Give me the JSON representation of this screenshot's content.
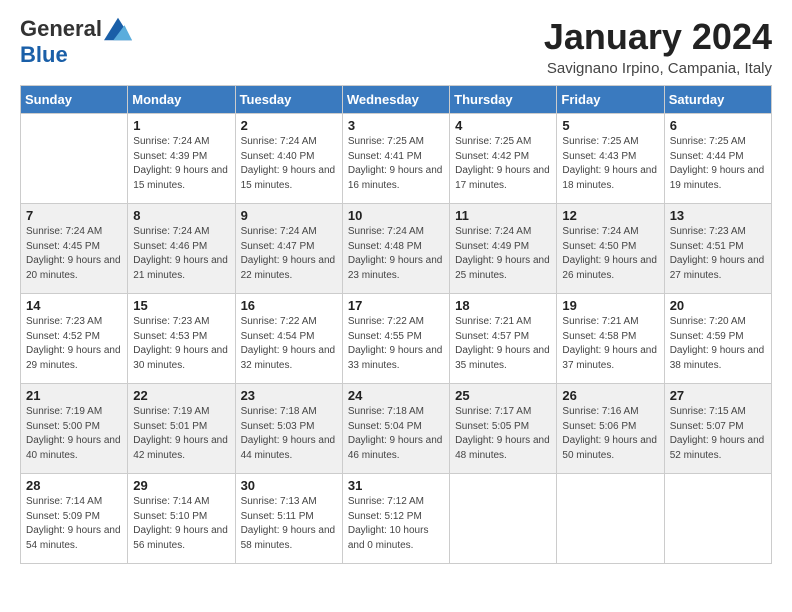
{
  "logo": {
    "general": "General",
    "blue": "Blue"
  },
  "title": "January 2024",
  "subtitle": "Savignano Irpino, Campania, Italy",
  "weekdays": [
    "Sunday",
    "Monday",
    "Tuesday",
    "Wednesday",
    "Thursday",
    "Friday",
    "Saturday"
  ],
  "weeks": [
    [
      {
        "day": "",
        "sunrise": "",
        "sunset": "",
        "daylight": ""
      },
      {
        "day": "1",
        "sunrise": "Sunrise: 7:24 AM",
        "sunset": "Sunset: 4:39 PM",
        "daylight": "Daylight: 9 hours and 15 minutes."
      },
      {
        "day": "2",
        "sunrise": "Sunrise: 7:24 AM",
        "sunset": "Sunset: 4:40 PM",
        "daylight": "Daylight: 9 hours and 15 minutes."
      },
      {
        "day": "3",
        "sunrise": "Sunrise: 7:25 AM",
        "sunset": "Sunset: 4:41 PM",
        "daylight": "Daylight: 9 hours and 16 minutes."
      },
      {
        "day": "4",
        "sunrise": "Sunrise: 7:25 AM",
        "sunset": "Sunset: 4:42 PM",
        "daylight": "Daylight: 9 hours and 17 minutes."
      },
      {
        "day": "5",
        "sunrise": "Sunrise: 7:25 AM",
        "sunset": "Sunset: 4:43 PM",
        "daylight": "Daylight: 9 hours and 18 minutes."
      },
      {
        "day": "6",
        "sunrise": "Sunrise: 7:25 AM",
        "sunset": "Sunset: 4:44 PM",
        "daylight": "Daylight: 9 hours and 19 minutes."
      }
    ],
    [
      {
        "day": "7",
        "sunrise": "Sunrise: 7:24 AM",
        "sunset": "Sunset: 4:45 PM",
        "daylight": "Daylight: 9 hours and 20 minutes."
      },
      {
        "day": "8",
        "sunrise": "Sunrise: 7:24 AM",
        "sunset": "Sunset: 4:46 PM",
        "daylight": "Daylight: 9 hours and 21 minutes."
      },
      {
        "day": "9",
        "sunrise": "Sunrise: 7:24 AM",
        "sunset": "Sunset: 4:47 PM",
        "daylight": "Daylight: 9 hours and 22 minutes."
      },
      {
        "day": "10",
        "sunrise": "Sunrise: 7:24 AM",
        "sunset": "Sunset: 4:48 PM",
        "daylight": "Daylight: 9 hours and 23 minutes."
      },
      {
        "day": "11",
        "sunrise": "Sunrise: 7:24 AM",
        "sunset": "Sunset: 4:49 PM",
        "daylight": "Daylight: 9 hours and 25 minutes."
      },
      {
        "day": "12",
        "sunrise": "Sunrise: 7:24 AM",
        "sunset": "Sunset: 4:50 PM",
        "daylight": "Daylight: 9 hours and 26 minutes."
      },
      {
        "day": "13",
        "sunrise": "Sunrise: 7:23 AM",
        "sunset": "Sunset: 4:51 PM",
        "daylight": "Daylight: 9 hours and 27 minutes."
      }
    ],
    [
      {
        "day": "14",
        "sunrise": "Sunrise: 7:23 AM",
        "sunset": "Sunset: 4:52 PM",
        "daylight": "Daylight: 9 hours and 29 minutes."
      },
      {
        "day": "15",
        "sunrise": "Sunrise: 7:23 AM",
        "sunset": "Sunset: 4:53 PM",
        "daylight": "Daylight: 9 hours and 30 minutes."
      },
      {
        "day": "16",
        "sunrise": "Sunrise: 7:22 AM",
        "sunset": "Sunset: 4:54 PM",
        "daylight": "Daylight: 9 hours and 32 minutes."
      },
      {
        "day": "17",
        "sunrise": "Sunrise: 7:22 AM",
        "sunset": "Sunset: 4:55 PM",
        "daylight": "Daylight: 9 hours and 33 minutes."
      },
      {
        "day": "18",
        "sunrise": "Sunrise: 7:21 AM",
        "sunset": "Sunset: 4:57 PM",
        "daylight": "Daylight: 9 hours and 35 minutes."
      },
      {
        "day": "19",
        "sunrise": "Sunrise: 7:21 AM",
        "sunset": "Sunset: 4:58 PM",
        "daylight": "Daylight: 9 hours and 37 minutes."
      },
      {
        "day": "20",
        "sunrise": "Sunrise: 7:20 AM",
        "sunset": "Sunset: 4:59 PM",
        "daylight": "Daylight: 9 hours and 38 minutes."
      }
    ],
    [
      {
        "day": "21",
        "sunrise": "Sunrise: 7:19 AM",
        "sunset": "Sunset: 5:00 PM",
        "daylight": "Daylight: 9 hours and 40 minutes."
      },
      {
        "day": "22",
        "sunrise": "Sunrise: 7:19 AM",
        "sunset": "Sunset: 5:01 PM",
        "daylight": "Daylight: 9 hours and 42 minutes."
      },
      {
        "day": "23",
        "sunrise": "Sunrise: 7:18 AM",
        "sunset": "Sunset: 5:03 PM",
        "daylight": "Daylight: 9 hours and 44 minutes."
      },
      {
        "day": "24",
        "sunrise": "Sunrise: 7:18 AM",
        "sunset": "Sunset: 5:04 PM",
        "daylight": "Daylight: 9 hours and 46 minutes."
      },
      {
        "day": "25",
        "sunrise": "Sunrise: 7:17 AM",
        "sunset": "Sunset: 5:05 PM",
        "daylight": "Daylight: 9 hours and 48 minutes."
      },
      {
        "day": "26",
        "sunrise": "Sunrise: 7:16 AM",
        "sunset": "Sunset: 5:06 PM",
        "daylight": "Daylight: 9 hours and 50 minutes."
      },
      {
        "day": "27",
        "sunrise": "Sunrise: 7:15 AM",
        "sunset": "Sunset: 5:07 PM",
        "daylight": "Daylight: 9 hours and 52 minutes."
      }
    ],
    [
      {
        "day": "28",
        "sunrise": "Sunrise: 7:14 AM",
        "sunset": "Sunset: 5:09 PM",
        "daylight": "Daylight: 9 hours and 54 minutes."
      },
      {
        "day": "29",
        "sunrise": "Sunrise: 7:14 AM",
        "sunset": "Sunset: 5:10 PM",
        "daylight": "Daylight: 9 hours and 56 minutes."
      },
      {
        "day": "30",
        "sunrise": "Sunrise: 7:13 AM",
        "sunset": "Sunset: 5:11 PM",
        "daylight": "Daylight: 9 hours and 58 minutes."
      },
      {
        "day": "31",
        "sunrise": "Sunrise: 7:12 AM",
        "sunset": "Sunset: 5:12 PM",
        "daylight": "Daylight: 10 hours and 0 minutes."
      },
      {
        "day": "",
        "sunrise": "",
        "sunset": "",
        "daylight": ""
      },
      {
        "day": "",
        "sunrise": "",
        "sunset": "",
        "daylight": ""
      },
      {
        "day": "",
        "sunrise": "",
        "sunset": "",
        "daylight": ""
      }
    ]
  ]
}
